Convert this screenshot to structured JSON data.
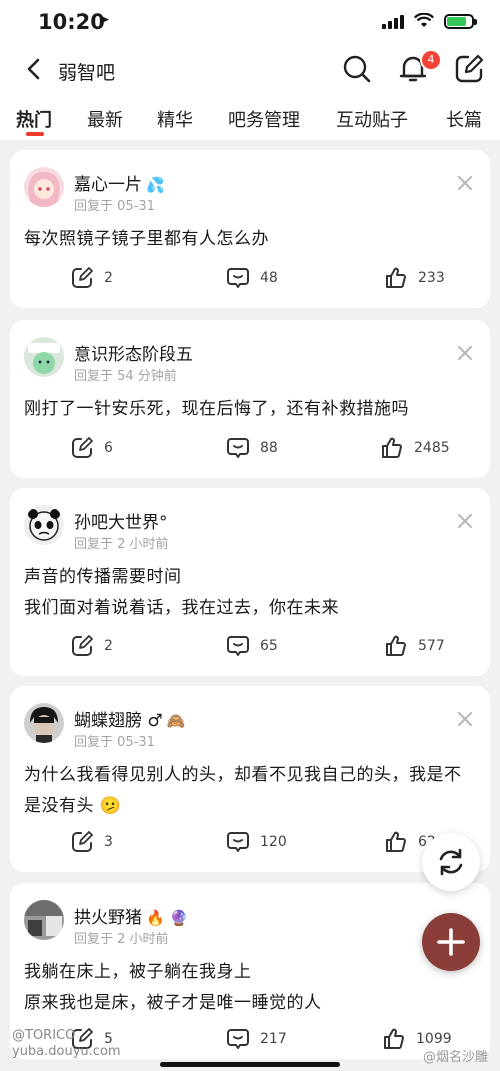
{
  "status": {
    "time": "10:20"
  },
  "header": {
    "title": "弱智吧",
    "notification_count": "4"
  },
  "tabs": [
    {
      "label": "热门",
      "active": true
    },
    {
      "label": "最新"
    },
    {
      "label": "精华"
    },
    {
      "label": "吧务管理"
    },
    {
      "label": "互动贴子"
    },
    {
      "label": "长篇"
    }
  ],
  "posts": [
    {
      "user": "嘉心一片",
      "emoji": "💦",
      "reply": "回复于 05-31",
      "lines": [
        "每次照镜子镜子里都有人怎么办"
      ],
      "shares": "2",
      "comments": "48",
      "likes": "233"
    },
    {
      "user": "意识形态阶段五",
      "emoji": "",
      "reply": "回复于 54 分钟前",
      "lines": [
        "刚打了一针安乐死，现在后悔了，还有补救措施吗"
      ],
      "shares": "6",
      "comments": "88",
      "likes": "2485"
    },
    {
      "user": "孙吧大世界°",
      "emoji": "",
      "reply": "回复于 2 小时前",
      "lines": [
        "声音的传播需要时间",
        "我们面对着说着话，我在过去，你在未来"
      ],
      "shares": "2",
      "comments": "65",
      "likes": "577"
    },
    {
      "user": "蝴蝶翅膀 ♂",
      "emoji": "🙈",
      "reply": "回复于 05-31",
      "lines": [
        "为什么我看得见别人的头，却看不见我自己的头，我是不是没有头 🫤"
      ],
      "shares": "3",
      "comments": "120",
      "likes": "62"
    },
    {
      "user": "拱火野猪",
      "emoji": "🔥 🔮",
      "reply": "回复于 2 小时前",
      "lines": [
        "我躺在床上，被子躺在我身上",
        "原来我也是床，被子才是唯一睡觉的人"
      ],
      "shares": "5",
      "comments": "217",
      "likes": "1099"
    }
  ],
  "watermarks": {
    "left_line1": "@TORICO",
    "left_line2": "yuba.douyu.com",
    "right": "@烟名沙雕"
  },
  "colors": {
    "accent": "#ef3a2f",
    "fab": "#8b3e39",
    "badge": "#f44336"
  }
}
